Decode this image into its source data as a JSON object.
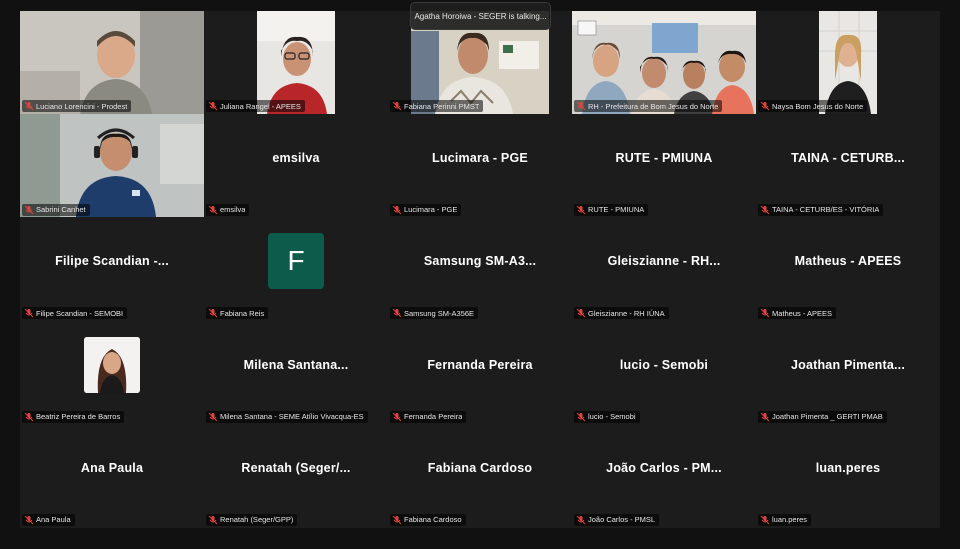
{
  "speaking_banner": "Agatha Horoiwa - SEGER is talking...",
  "colors": {
    "accent_avatar": "#0d5c4b",
    "muted_mic": "#e0463c"
  },
  "participants": [
    {
      "label": "Luciano Lorencini - Prodest",
      "display": "",
      "type": "video"
    },
    {
      "label": "Juliana Rangel - APEES",
      "display": "",
      "type": "video"
    },
    {
      "label": "Fabiana Perinni PMST",
      "display": "",
      "type": "video"
    },
    {
      "label": "RH - Prefeitura de Bom Jesus do Norte",
      "display": "",
      "type": "video"
    },
    {
      "label": "Naysa Bom Jesus do Norte",
      "display": "",
      "type": "video"
    },
    {
      "label": "Sabrini Canhet",
      "display": "",
      "type": "video"
    },
    {
      "label": "emsilva",
      "display": "emsilva",
      "type": "name"
    },
    {
      "label": "Lucimara - PGE",
      "display": "Lucimara - PGE",
      "type": "name"
    },
    {
      "label": "RUTE - PMIUNA",
      "display": "RUTE - PMIUNA",
      "type": "name"
    },
    {
      "label": "TAINA - CETURB/ES - VITÓRIA",
      "display": "TAINA - CETURB...",
      "type": "name"
    },
    {
      "label": "Filipe Scandian - SEMOBI",
      "display": "Filipe Scandian -...",
      "type": "name"
    },
    {
      "label": "Fabiana Reis",
      "display": "F",
      "type": "avatar"
    },
    {
      "label": "Samsung SM-A356E",
      "display": "Samsung SM-A3...",
      "type": "name"
    },
    {
      "label": "Gleiszianne - RH IÚNA",
      "display": "Gleiszianne - RH...",
      "type": "name"
    },
    {
      "label": "Matheus - APEES",
      "display": "Matheus - APEES",
      "type": "name"
    },
    {
      "label": "Beatriz Pereira de Barros",
      "display": "",
      "type": "photo"
    },
    {
      "label": "Milena Santana - SEME Atílio Vivacqua-ES",
      "display": "Milena Santana...",
      "type": "name"
    },
    {
      "label": "Fernanda Pereira",
      "display": "Fernanda Pereira",
      "type": "name"
    },
    {
      "label": "lucio - Semobi",
      "display": "lucio - Semobi",
      "type": "name"
    },
    {
      "label": "Joathan Pimenta _ GERTI PMAB",
      "display": "Joathan Pimenta...",
      "type": "name"
    },
    {
      "label": "Ana Paula",
      "display": "Ana Paula",
      "type": "name"
    },
    {
      "label": "Renatah (Seger/GPP)",
      "display": "Renatah (Seger/...",
      "type": "name"
    },
    {
      "label": "Fabiana Cardoso",
      "display": "Fabiana Cardoso",
      "type": "name"
    },
    {
      "label": "João Carlos - PMSL",
      "display": "João Carlos - PM...",
      "type": "name"
    },
    {
      "label": "luan.peres",
      "display": "luan.peres",
      "type": "name"
    }
  ]
}
